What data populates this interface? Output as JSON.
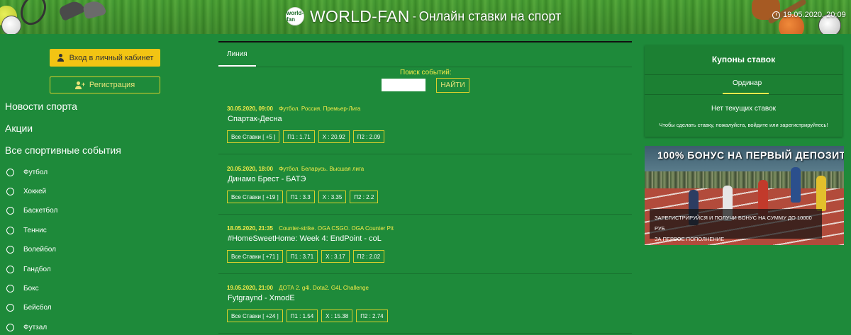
{
  "header": {
    "logo_text": "world-fan",
    "brand": "WORLD-FAN",
    "separator": "-",
    "tagline": "Онлайн ставки на спорт",
    "datetime": "19.05.2020, 20:09"
  },
  "sidebar": {
    "login_label": "Вход в личный кабинет",
    "register_label": "Регистрация",
    "sections": [
      "Новости спорта",
      "Акции",
      "Все спортивные события"
    ],
    "sports": [
      "Футбол",
      "Хоккей",
      "Баскетбол",
      "Теннис",
      "Волейбол",
      "Гандбол",
      "Бокс",
      "Бейсбол",
      "Футзал"
    ]
  },
  "main": {
    "tab_label": "Линия",
    "search_label": "Поиск событий:",
    "search_value": "",
    "search_button": "НАЙТИ",
    "events": [
      {
        "date": "30.05.2020, 09:00",
        "league": "Футбол. Россия. Премьер-Лига",
        "title": "Спартак-Десна",
        "all_bets": "Все Ставки [ +5 ]",
        "p1": "П1 : 1.71",
        "x": "X : 20.92",
        "p2": "П2 : 2.09"
      },
      {
        "date": "20.05.2020, 18:00",
        "league": "Футбол. Беларусь. Высшая лига",
        "title": "Динамо Брест - БАТЭ",
        "all_bets": "Все Ставки [ +19 ]",
        "p1": "П1 : 3.3",
        "x": "X : 3.35",
        "p2": "П2 : 2.2"
      },
      {
        "date": "18.05.2020, 21:35",
        "league": "Counter-strike. OGA CSGO. OGA Counter Pit",
        "title": "#HomeSweetHome: Week 4: EndPoint - coL",
        "all_bets": "Все Ставки [ +71 ]",
        "p1": "П1 : 3.71",
        "x": "X : 3.17",
        "p2": "П2 : 2.02"
      },
      {
        "date": "19.05.2020, 21:00",
        "league": "ДОТА 2. g4l. Dota2. G4L Challenge",
        "title": "Fytgraynd - XmodE",
        "all_bets": "Все Ставки [ +24 ]",
        "p1": "П1 : 1.54",
        "x": "X : 15.38",
        "p2": "П2 : 2.74"
      }
    ]
  },
  "coupon": {
    "title": "Купоны ставок",
    "tab": "Ординар",
    "empty": "Нет текущих ставок",
    "hint": "Чтобы сделать ставку, пожалуйста, войдите или зарегистрируйтесь!"
  },
  "promo": {
    "headline": "100% БОНУС НА ПЕРВЫЙ ДЕПОЗИТ",
    "line1": "ЗАРЕГИСТРИРУЙСЯ И ПОЛУЧИ БОНУС НА СУММУ ДО 10000 РУБ",
    "line2": "ЗА ПЕРВОЕ ПОПОЛНЕНИЕ"
  },
  "colors": {
    "background": "#1e8a3a",
    "accent_yellow": "#f2c413",
    "text_yellow": "#f3ea4a",
    "border_yellow": "#d8cf2c"
  }
}
